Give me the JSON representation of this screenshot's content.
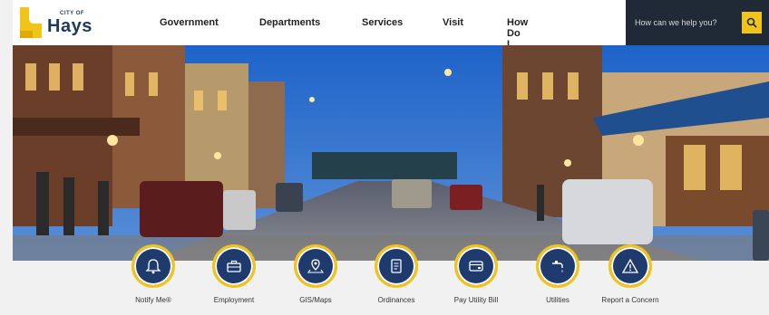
{
  "header": {
    "logo_small": "CITY OF",
    "logo_word": "Hays",
    "nav": [
      "Government",
      "Departments",
      "Services",
      "Visit",
      "How Do I..."
    ],
    "search": {
      "placeholder": "How can we help you?"
    }
  },
  "quick_links": [
    {
      "label": "Notify Me®",
      "icon": "bell-icon"
    },
    {
      "label": "Employment",
      "icon": "briefcase-icon"
    },
    {
      "label": "GIS/Maps",
      "icon": "map-pin-icon"
    },
    {
      "label": "Ordinances",
      "icon": "document-icon"
    },
    {
      "label": "Pay Utility Bill",
      "icon": "credit-card-icon"
    },
    {
      "label": "Utilities",
      "icon": "faucet-icon"
    },
    {
      "label": "Report a Concern",
      "icon": "warning-icon"
    }
  ],
  "colors": {
    "navy": "#1f3a6d",
    "gold": "#f0c419",
    "dark": "#1f2a36"
  }
}
